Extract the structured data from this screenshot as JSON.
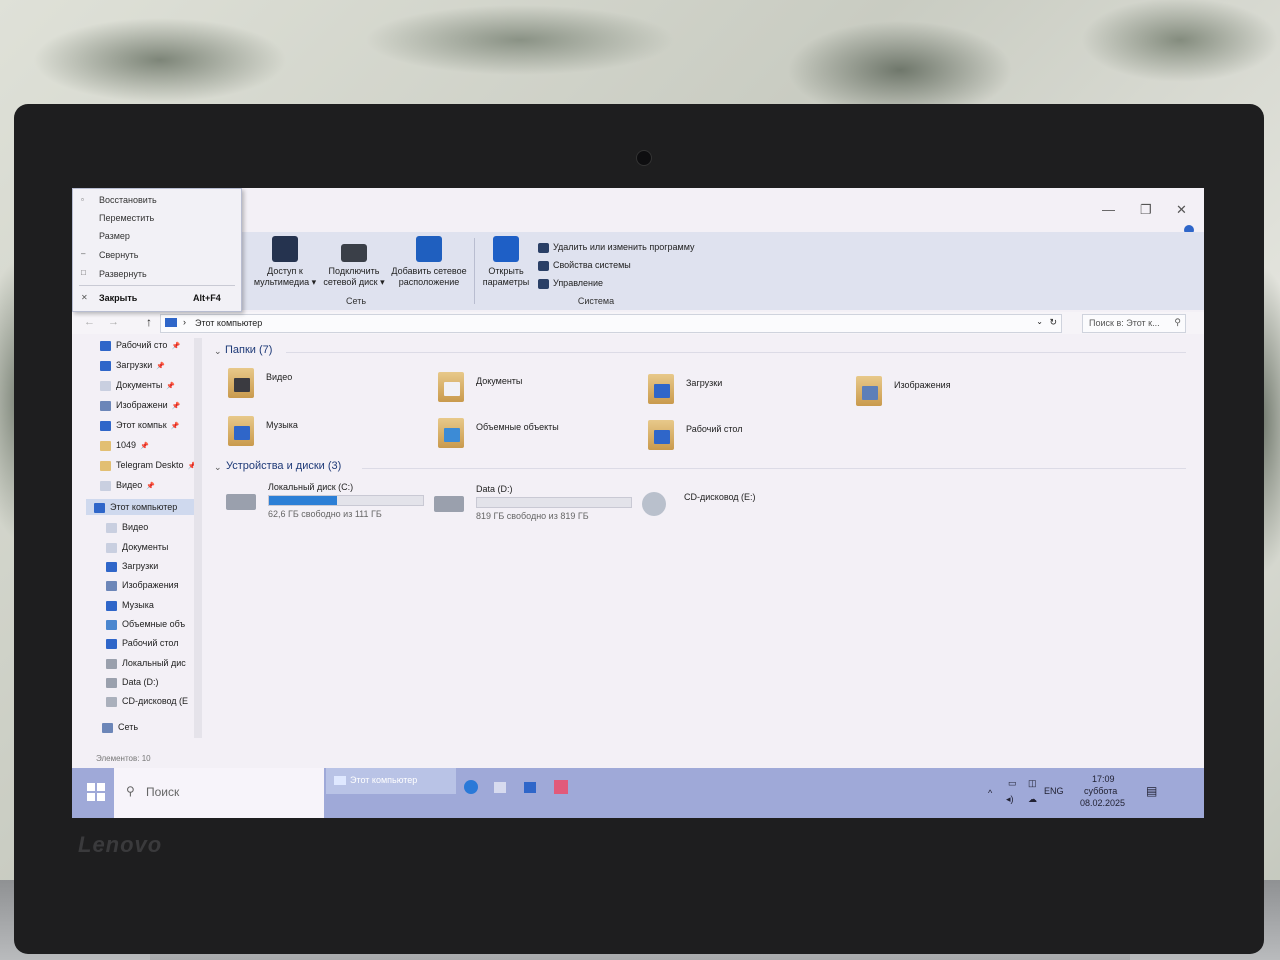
{
  "laptop": {
    "brand": "Lenovo"
  },
  "explorer": {
    "ribbon": {
      "network_group": {
        "label": "Сеть",
        "buttons": [
          {
            "label": "Доступ к мультимедиа ▾"
          },
          {
            "label": "Подключить сетевой диск ▾"
          },
          {
            "label": "Добавить сетевое расположение"
          }
        ]
      },
      "system_group": {
        "label": "Система",
        "open_settings": "Открыть параметры",
        "actions": [
          {
            "label": "Удалить или изменить программу"
          },
          {
            "label": "Свойства системы"
          },
          {
            "label": "Управление"
          }
        ]
      }
    },
    "address": {
      "path": "Этот компьютер",
      "search_placeholder": "Поиск в: Этот к..."
    },
    "nav_pane": {
      "quick_access": [
        {
          "label": "Рабочий сто",
          "icon": "desktop-icon"
        },
        {
          "label": "Загрузки",
          "icon": "download-icon"
        },
        {
          "label": "Документы",
          "icon": "document-icon"
        },
        {
          "label": "Изображени",
          "icon": "image-icon"
        },
        {
          "label": "Этот компьк",
          "icon": "computer-icon"
        },
        {
          "label": "1049",
          "icon": "folder-icon"
        },
        {
          "label": "Telegram Deskto",
          "icon": "folder-icon"
        },
        {
          "label": "Видео",
          "icon": "video-icon"
        }
      ],
      "this_pc": {
        "label": "Этот компьютер"
      },
      "this_pc_items": [
        {
          "label": "Видео",
          "icon": "video-icon"
        },
        {
          "label": "Документы",
          "icon": "document-icon"
        },
        {
          "label": "Загрузки",
          "icon": "download-icon"
        },
        {
          "label": "Изображения",
          "icon": "image-icon"
        },
        {
          "label": "Музыка",
          "icon": "music-icon"
        },
        {
          "label": "Объемные объ",
          "icon": "cube-icon"
        },
        {
          "label": "Рабочий стол",
          "icon": "desktop-icon"
        },
        {
          "label": "Локальный дис",
          "icon": "drive-icon"
        },
        {
          "label": "Data (D:)",
          "icon": "drive-icon"
        },
        {
          "label": "CD-дисковод (E",
          "icon": "cd-icon"
        }
      ],
      "network": {
        "label": "Сеть"
      }
    },
    "folders_section": {
      "title": "Папки (7)"
    },
    "folders": [
      {
        "label": "Видео"
      },
      {
        "label": "Документы"
      },
      {
        "label": "Загрузки"
      },
      {
        "label": "Изображения"
      },
      {
        "label": "Музыка"
      },
      {
        "label": "Объемные объекты"
      },
      {
        "label": "Рабочий стол"
      }
    ],
    "devices_section": {
      "title": "Устройства и диски (3)"
    },
    "drives": [
      {
        "name": "Локальный диск (C:)",
        "free": "62,6 ГБ свободно из 111 ГБ",
        "used_fraction": 0.44
      },
      {
        "name": "Data (D:)",
        "free": "819 ГБ свободно из 819 ГБ",
        "used_fraction": 0.0
      },
      {
        "name": "CD-дисковод (E:)"
      }
    ],
    "status": "Элементов: 10"
  },
  "context_menu": {
    "items": [
      {
        "label": "Восстановить"
      },
      {
        "label": "Переместить"
      },
      {
        "label": "Размер"
      },
      {
        "label": "Свернуть"
      },
      {
        "label": "Развернуть"
      },
      {
        "label": "Закрыть",
        "shortcut": "Alt+F4"
      }
    ]
  },
  "taskbar": {
    "search_placeholder": "Поиск",
    "active_app": "Этот компьютер",
    "language": "ENG",
    "time": "17:09",
    "day": "суббота",
    "date": "08.02.2025"
  }
}
